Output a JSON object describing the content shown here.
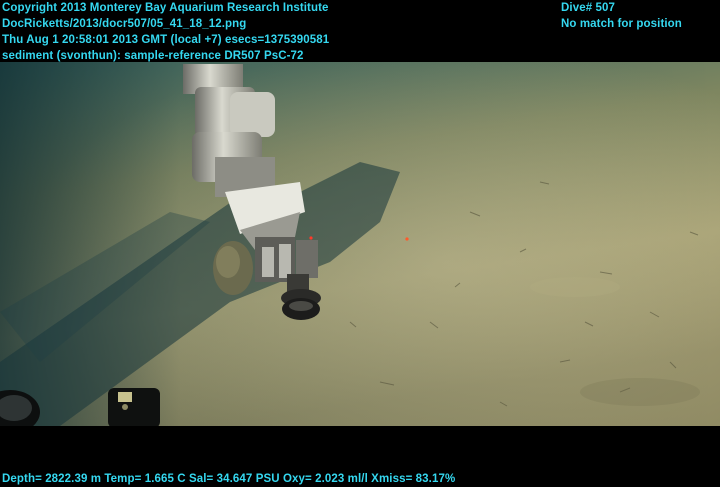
{
  "overlay": {
    "top_left": [
      "Copyright 2013 Monterey Bay Aquarium Research Institute",
      "DocRicketts/2013/docr507/05_41_18_12.png",
      "Thu Aug  1 20:58:01 2013 GMT (local +7)  esecs=1375390581",
      "sediment (svonthun): sample-reference DR507 PsC-72"
    ],
    "top_right": [
      "Dive# 507",
      "No match for position"
    ],
    "bottom": "Depth= 2822.39 m  Temp= 1.665 C  Sal= 34.647 PSU  Oxy= 2.023 ml/l  Xmiss= 83.17%"
  },
  "colors": {
    "overlay_text": "#35d8f0",
    "seafloor": "#9a9a68",
    "water": "#1f4f52"
  }
}
